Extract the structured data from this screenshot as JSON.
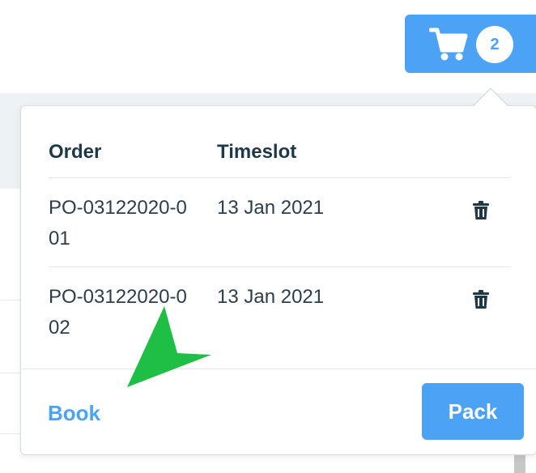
{
  "cart": {
    "count": "2",
    "icon": "cart-icon"
  },
  "table": {
    "headers": {
      "order": "Order",
      "timeslot": "Timeslot"
    },
    "rows": [
      {
        "order": "PO-03122020-001",
        "timeslot": "13 Jan 2021",
        "icon": "trash-icon"
      },
      {
        "order": "PO-03122020-002",
        "timeslot": "13 Jan 2021",
        "icon": "trash-icon"
      }
    ]
  },
  "footer": {
    "book_label": "Book",
    "pack_label": "Pack"
  },
  "colors": {
    "accent": "#4ca3f5",
    "text": "#1f3847",
    "pointer": "#1fbf46"
  }
}
